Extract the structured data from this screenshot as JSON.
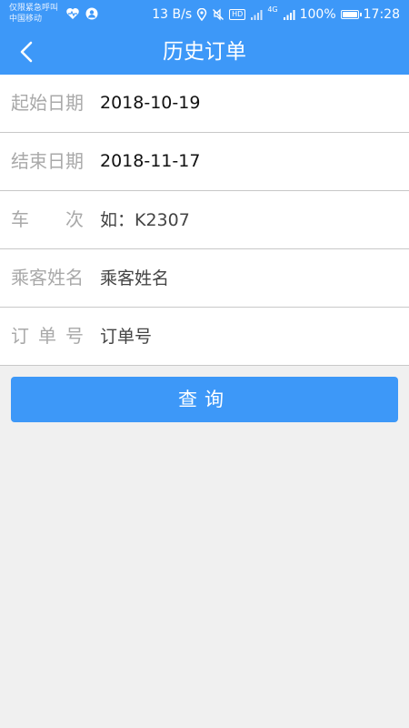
{
  "status_bar": {
    "carrier_line1": "仅限紧急呼叫",
    "carrier_line2": "中国移动",
    "net_speed": "13 B/s",
    "hd_label": "HD",
    "network_label": "4G",
    "battery": "100%",
    "time": "17:28",
    "icons": [
      "heart-rate-icon",
      "user-icon",
      "location-icon",
      "mute-icon",
      "signal-icon",
      "battery-icon"
    ]
  },
  "header": {
    "title": "历史订单",
    "back_icon": "chevron-left-icon"
  },
  "form": {
    "start_date": {
      "label": "起始日期",
      "value": "2018-10-19"
    },
    "end_date": {
      "label": "结束日期",
      "value": "2018-11-17"
    },
    "train_no": {
      "label_chars": [
        "车",
        "次"
      ],
      "placeholder": "如：K2307"
    },
    "passenger": {
      "label": "乘客姓名",
      "placeholder": "乘客姓名"
    },
    "order_no": {
      "label_chars": [
        "订",
        "单",
        "号"
      ],
      "placeholder": "订单号"
    }
  },
  "query_button": {
    "label": "查询"
  },
  "colors": {
    "primary": "#3d98f8",
    "background": "#f0f0f0",
    "label": "#a9a9a9",
    "divider": "#c8c8c8"
  }
}
